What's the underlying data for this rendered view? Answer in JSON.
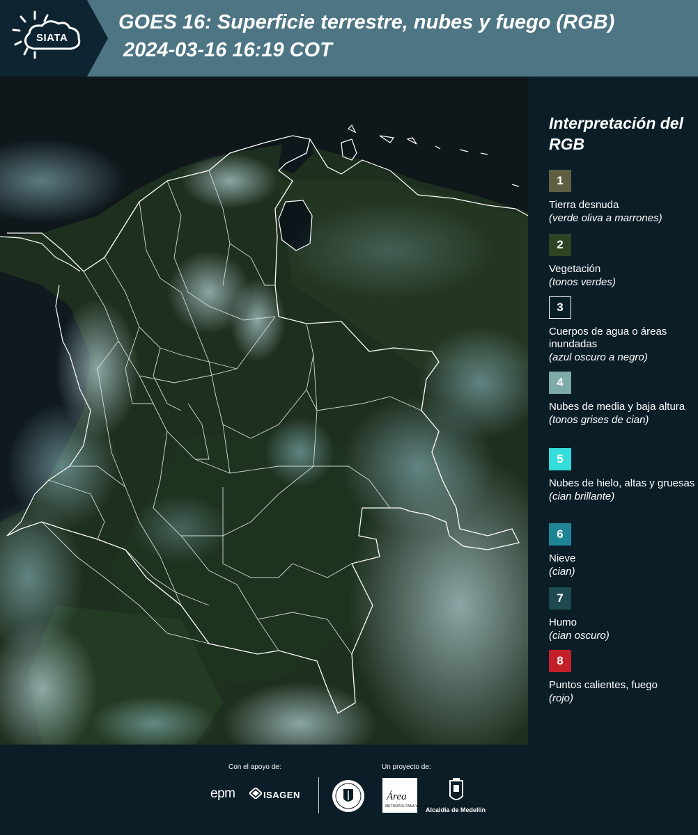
{
  "header": {
    "logo_text": "SIATA",
    "title": "GOES 16: Superficie terrestre, nubes y fuego (RGB)",
    "subtitle": "2024-03-16 16:19 COT"
  },
  "legend": {
    "title": "Interpretación del RGB",
    "items": [
      {
        "num": "1",
        "label": "Tierra desnuda",
        "sub": "(verde oliva a marrones)",
        "color": "#5f5e40"
      },
      {
        "num": "2",
        "label": "Vegetación",
        "sub": "(tonos verdes)",
        "color": "#2e4322"
      },
      {
        "num": "3",
        "label": "Cuerpos de agua o áreas inundadas",
        "sub": "(azul oscuro a negro)",
        "color": "#0b1e28"
      },
      {
        "num": "4",
        "label": "Nubes de media y baja altura",
        "sub": "(tonos grises de cian)",
        "color": "#7eaaa8"
      },
      {
        "num": "5",
        "label": "Nubes de hielo, altas y gruesas",
        "sub": "(cian brillante)",
        "color": "#35dcdc"
      },
      {
        "num": "6",
        "label": "Nieve",
        "sub": "(cian)",
        "color": "#1e8496"
      },
      {
        "num": "7",
        "label": "Humo",
        "sub": "(cian oscuro)",
        "color": "#1c4a50"
      },
      {
        "num": "8",
        "label": "Puntos calientes, fuego",
        "sub": "(rojo)",
        "color": "#c4202a"
      }
    ]
  },
  "footer": {
    "support_label": "Con el apoyo de:",
    "project_label": "Un proyecto de:",
    "epm": "epm",
    "isagen": "ISAGEN",
    "area_logo": "Área",
    "area_sub": "METROPOLITANA Valle de Aburrá",
    "alcaldia": "Alcaldía de Medellín"
  }
}
